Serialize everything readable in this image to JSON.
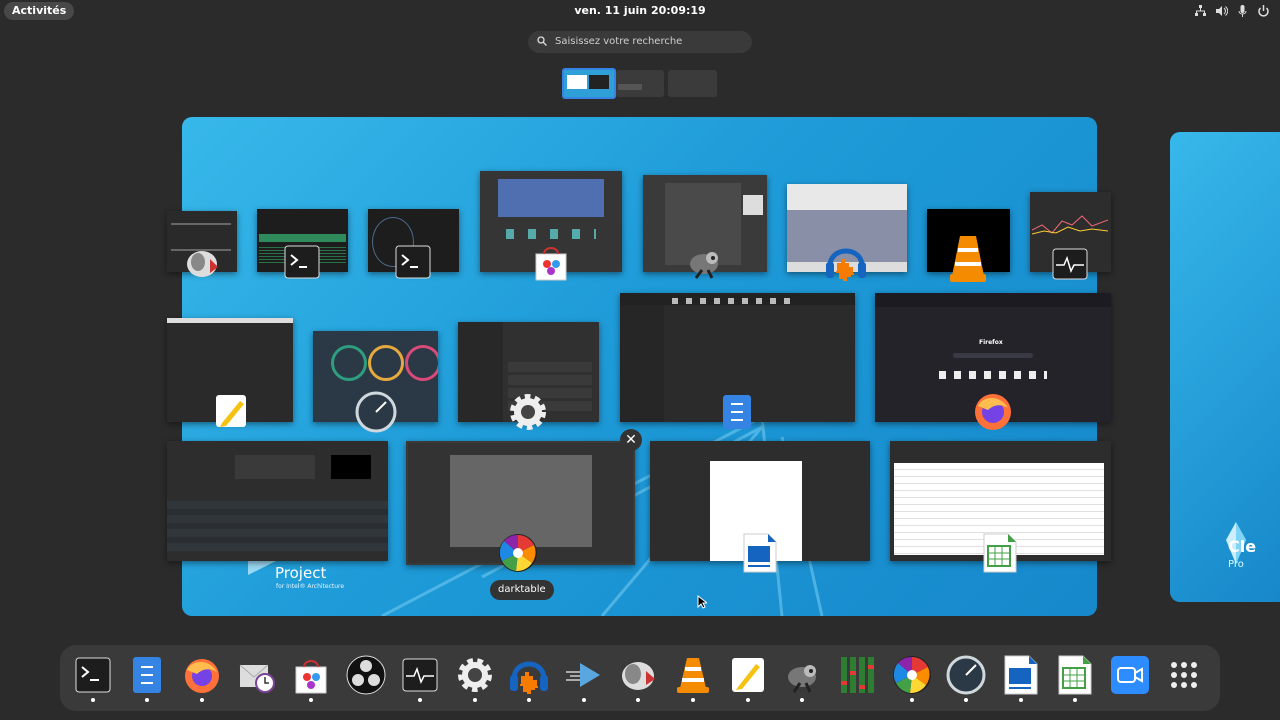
{
  "topbar": {
    "activities_label": "Activités",
    "clock": "ven. 11 juin  20:09:19",
    "tray_icons": [
      "network-icon",
      "volume-icon",
      "microphone-icon",
      "power-icon"
    ]
  },
  "search": {
    "placeholder": "Saisissez votre recherche"
  },
  "workspace_thumbnails": [
    "workspace-1",
    "workspace-2",
    "workspace-3"
  ],
  "windows": [
    {
      "name": "window-rstudio-like",
      "icon": "gnome-photos-icon"
    },
    {
      "name": "window-terminal-1",
      "icon": "terminal-icon"
    },
    {
      "name": "window-terminal-2",
      "icon": "terminal-icon"
    },
    {
      "name": "window-software-store",
      "icon": "software-store-icon"
    },
    {
      "name": "window-gimp",
      "icon": "gimp-icon"
    },
    {
      "name": "window-audacity",
      "icon": "audacity-icon"
    },
    {
      "name": "window-vlc",
      "icon": "vlc-icon"
    },
    {
      "name": "window-system-monitor",
      "icon": "system-monitor-icon"
    },
    {
      "name": "window-text-editor",
      "icon": "text-editor-icon"
    },
    {
      "name": "window-stacer",
      "icon": "stacer-icon"
    },
    {
      "name": "window-settings",
      "icon": "settings-icon"
    },
    {
      "name": "window-files",
      "icon": "files-icon"
    },
    {
      "name": "window-firefox",
      "icon": "firefox-icon"
    },
    {
      "name": "window-kdenlive",
      "icon": "kdenlive-icon"
    },
    {
      "name": "window-darktable",
      "icon": "darktable-icon"
    },
    {
      "name": "window-writer",
      "icon": "writer-icon"
    },
    {
      "name": "window-calc",
      "icon": "calc-icon"
    }
  ],
  "workspace_text": {
    "project": "Project",
    "project_sub": "for Intel® Architecture",
    "next_title": "Cle",
    "next_sub": "Pro"
  },
  "firefox_window_title": "Firefox",
  "tooltip": "darktable",
  "dock": [
    "terminal-icon",
    "files-icon",
    "firefox-icon",
    "evolution-icon",
    "software-store-icon",
    "obs-icon",
    "system-monitor-icon",
    "settings-icon",
    "audacity-icon",
    "kdenlive-icon",
    "gnome-photos-icon",
    "vlc-icon",
    "text-editor-icon",
    "gimp-icon",
    "mixer-icon",
    "darktable-icon",
    "stacer-icon",
    "writer-icon",
    "calc-icon",
    "zoom-icon",
    "app-grid-icon"
  ],
  "colors": {
    "accent": "#3584e4",
    "wallpaper": "#1e9bd8",
    "panel": "#2b2b2b",
    "dock": "#3a3a3a"
  }
}
